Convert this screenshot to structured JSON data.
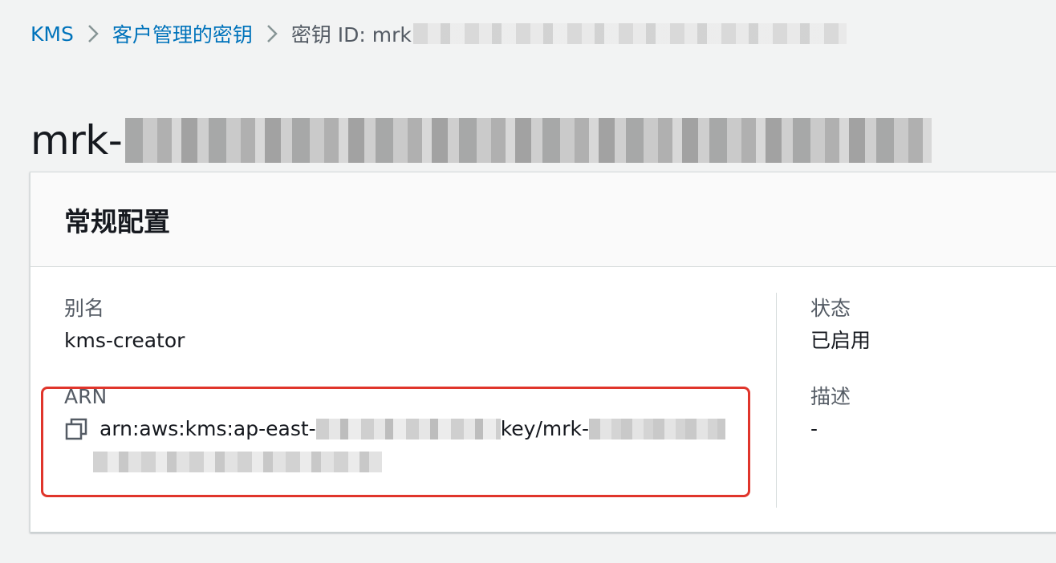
{
  "breadcrumb": {
    "items": [
      {
        "label": "KMS"
      },
      {
        "label": "客户管理的密钥"
      },
      {
        "label": "密钥 ID: mrk"
      }
    ]
  },
  "page": {
    "title_prefix": "mrk-"
  },
  "panel": {
    "title": "常规配置",
    "alias": {
      "label": "别名",
      "value": "kms-creator"
    },
    "arn": {
      "label": "ARN",
      "value_start": "arn:aws:kms:ap-east-",
      "value_middle": "key/mrk-"
    },
    "status": {
      "label": "状态",
      "value": "已启用"
    },
    "description": {
      "label": "描述",
      "value": "-"
    }
  },
  "colors": {
    "link": "#0073bb",
    "highlight": "#e0352b",
    "background": "#f2f3f3"
  },
  "icons": {
    "separator": "chevron-right-icon",
    "copy": "copy-icon"
  }
}
